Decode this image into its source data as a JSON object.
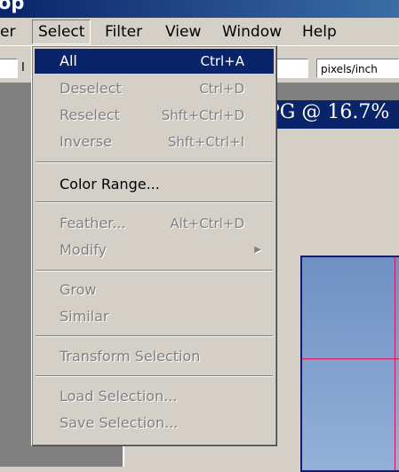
{
  "app": {
    "title_fragment": "op"
  },
  "menubar": {
    "items": [
      {
        "label": "er"
      },
      {
        "label": "Select"
      },
      {
        "label": "Filter"
      },
      {
        "label": "View"
      },
      {
        "label": "Window"
      },
      {
        "label": "Help"
      }
    ]
  },
  "options": {
    "left_fragment": "I",
    "resolution_unit": "pixels/inch"
  },
  "document": {
    "title_fragment": "PG @ 16.7%"
  },
  "select_menu": {
    "all": {
      "label": "All",
      "shortcut": "Ctrl+A"
    },
    "deselect": {
      "label": "Deselect",
      "shortcut": "Ctrl+D"
    },
    "reselect": {
      "label": "Reselect",
      "shortcut": "Shft+Ctrl+D"
    },
    "inverse": {
      "label": "Inverse",
      "shortcut": "Shft+Ctrl+I"
    },
    "color_range": {
      "label": "Color Range..."
    },
    "feather": {
      "label": "Feather...",
      "shortcut": "Alt+Ctrl+D"
    },
    "modify": {
      "label": "Modify"
    },
    "grow": {
      "label": "Grow"
    },
    "similar": {
      "label": "Similar"
    },
    "transform_selection": {
      "label": "Transform Selection"
    },
    "load_selection": {
      "label": "Load Selection..."
    },
    "save_selection": {
      "label": "Save Selection..."
    }
  },
  "colors": {
    "highlight": "#0a246a",
    "menu_bg": "#d4d0c8",
    "guide": "#d4145a"
  }
}
